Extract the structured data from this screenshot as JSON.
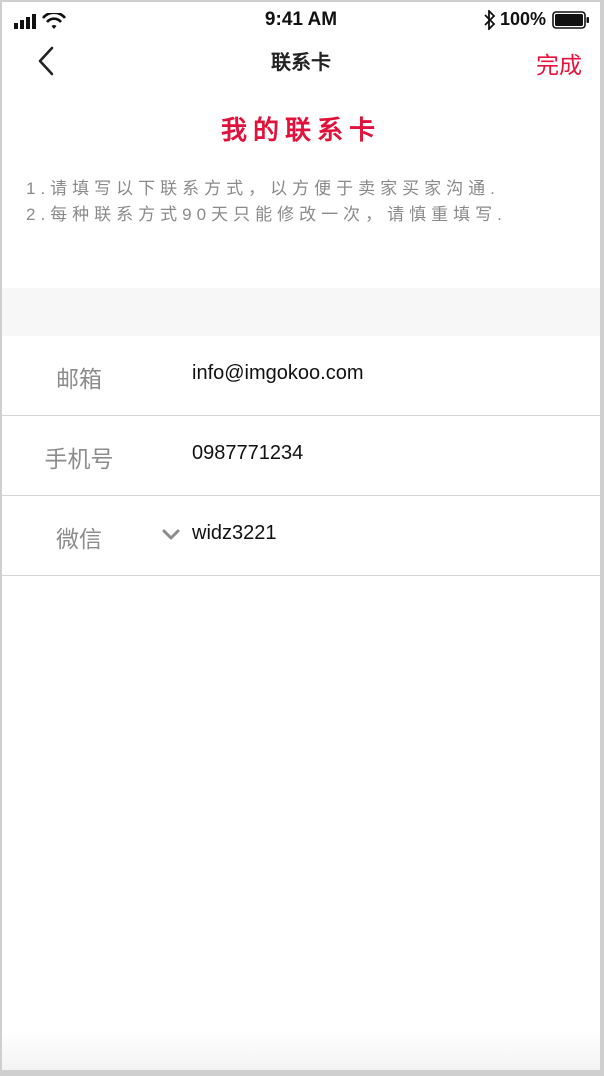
{
  "status_bar": {
    "time": "9:41 AM",
    "battery": "100%"
  },
  "nav": {
    "title": "联系卡",
    "done_label": "完成"
  },
  "card": {
    "title": "我的联系卡",
    "notes": [
      "1.请填写以下联系方式，以方便于卖家买家沟通.",
      "2.每种联系方式90天只能修改一次，请慎重填写."
    ]
  },
  "contacts": [
    {
      "label": "邮箱",
      "value": "info@imgokoo.com"
    },
    {
      "label": "手机号",
      "value": "0987771234"
    },
    {
      "label": "微信",
      "value": "widz3221"
    }
  ],
  "colors": {
    "accent": "#e8123c",
    "label_gray": "#8c8c8c",
    "divider": "#d6d6d6"
  }
}
